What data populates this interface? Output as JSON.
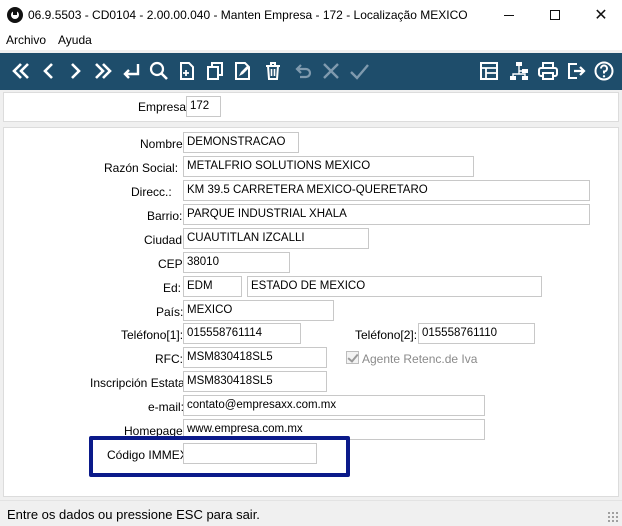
{
  "window": {
    "title": "06.9.5503 - CD0104 - 2.00.00.040 - Manten Empresa - 172 - Localização MEXICO",
    "minimize_glyph": "",
    "close_glyph": "✕"
  },
  "menu": {
    "items": [
      {
        "label": "Archivo"
      },
      {
        "label": "Ayuda"
      }
    ]
  },
  "toolbar": {
    "accent": "#1e4d6b",
    "buttons": [
      {
        "icon": "double-chevron-left-icon"
      },
      {
        "icon": "chevron-left-icon"
      },
      {
        "icon": "chevron-right-icon"
      },
      {
        "icon": "double-chevron-right-icon"
      },
      {
        "icon": "enter-icon"
      },
      {
        "icon": "search-icon"
      },
      {
        "icon": "new-document-icon"
      },
      {
        "icon": "copy-icon"
      },
      {
        "icon": "edit-document-icon"
      },
      {
        "icon": "trash-icon"
      },
      {
        "icon": "undo-icon"
      },
      {
        "icon": "cancel-icon"
      },
      {
        "icon": "confirm-icon"
      },
      {
        "icon": "grid-layout-icon"
      },
      {
        "icon": "tree-icon"
      },
      {
        "icon": "printer-icon"
      },
      {
        "icon": "exit-icon"
      },
      {
        "icon": "help-icon"
      }
    ]
  },
  "header": {
    "empresa_label": "Empresa:",
    "empresa_value": "172"
  },
  "form": {
    "nombre_label": "Nombre:",
    "nombre_value": "DEMONSTRACAO",
    "razon_label": "Razón Social:",
    "razon_value": "METALFRIO SOLUTIONS MEXICO",
    "direcc_label": "Direcc.:",
    "direcc_value": "KM 39.5 CARRETERA MEXICO-QUERETARO",
    "barrio_label": "Barrio:",
    "barrio_value": "PARQUE INDUSTRIAL XHALA",
    "ciudad_label": "Ciudad:",
    "ciudad_value": "CUAUTITLAN IZCALLI",
    "cep_label": "CEP:",
    "cep_value": "38010",
    "ed_label": "Ed:",
    "ed_code": "EDM",
    "ed_name": "ESTADO DE MEXICO",
    "pais_label": "País:",
    "pais_value": "MEXICO",
    "tel1_label": "Teléfono[1]:",
    "tel1_value": "015558761114",
    "tel2_label": "Teléfono[2]:",
    "tel2_value": "015558761110",
    "rfc_label": "RFC:",
    "rfc_value": "MSM830418SL5",
    "agente_label": "Agente Retenc.de Iva",
    "agente_checked": true,
    "inscripcion_label": "Inscripción Estatal:",
    "inscripcion_value": "MSM830418SL5",
    "email_label": "e-mail:",
    "email_value": "contato@empresaxx.com.mx",
    "homepage_label": "Homepage:",
    "homepage_value": "www.empresa.com.mx",
    "immex_label": "Código IMMEX:",
    "immex_value": "",
    "highlight_color": "#0b1a8a"
  },
  "status": {
    "text": "Entre os dados ou pressione ESC para sair."
  }
}
